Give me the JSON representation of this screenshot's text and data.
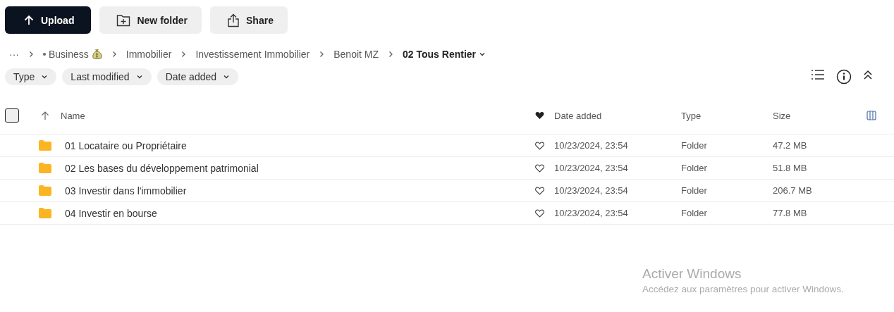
{
  "toolbar": {
    "buttons": [
      {
        "label": "Upload",
        "kind": "primary"
      },
      {
        "label": "New folder",
        "kind": "new-folder"
      },
      {
        "label": "Share",
        "kind": "share"
      }
    ]
  },
  "breadcrumb": {
    "items": [
      {
        "label": "···",
        "kind": "more"
      },
      {
        "label": "Business",
        "kind": "tagged"
      },
      {
        "label": "Immobilier",
        "kind": "plain"
      },
      {
        "label": "Investissement Immobilier",
        "kind": "plain"
      },
      {
        "label": "Benoit MZ",
        "kind": "plain"
      },
      {
        "label": "02 Tous Rentier",
        "kind": "current"
      }
    ]
  },
  "filters": [
    "Type",
    "Last modified",
    "Date added"
  ],
  "table": {
    "select_all": {
      "checked": false
    },
    "columns": [
      "Name",
      "Date added",
      "Type",
      "Size"
    ],
    "rows": [
      {
        "name": "01 Locataire ou Propriétaire",
        "favorite": false,
        "date_added": "10/23/2024, 23:54",
        "type": "Folder",
        "size": "47.2 MB"
      },
      {
        "name": "02 Les bases du développement patrimonial",
        "favorite": false,
        "date_added": "10/23/2024, 23:54",
        "type": "Folder",
        "size": "51.8 MB"
      },
      {
        "name": "03 Investir dans l'immobilier",
        "favorite": false,
        "date_added": "10/23/2024, 23:54",
        "type": "Folder",
        "size": "206.7 MB"
      },
      {
        "name": "04 Investir en bourse",
        "favorite": false,
        "date_added": "10/23/2024, 23:54",
        "type": "Folder",
        "size": "77.8 MB"
      }
    ]
  },
  "windows_activation_notice": {
    "title": "Activer Windows",
    "text": "Accédez aux paramètres pour activer Windows."
  }
}
